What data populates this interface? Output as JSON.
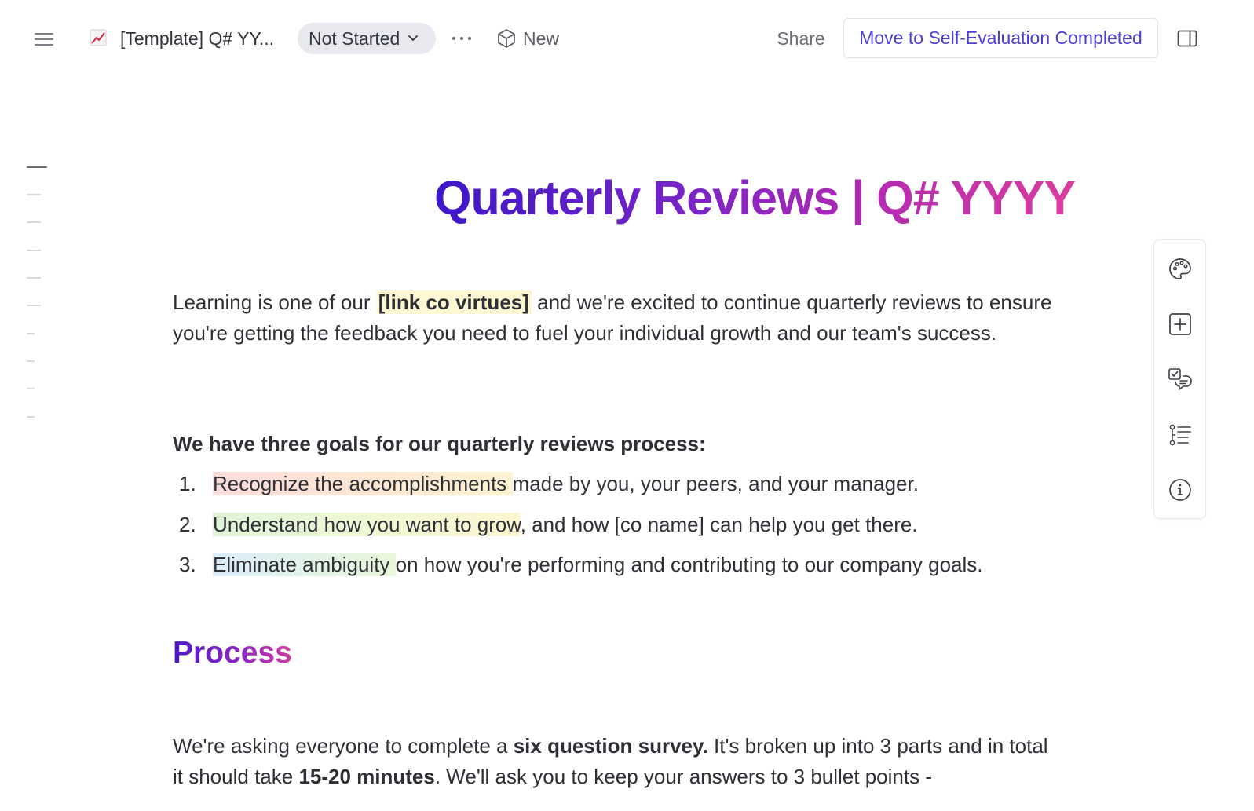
{
  "topbar": {
    "doc_icon": "chart-increasing-emoji-icon",
    "doc_title": "[Template] Q# YY...",
    "status": "Not Started",
    "new_label": "New",
    "share_label": "Share",
    "move_label": "Move to Self-Evaluation Completed"
  },
  "outline": {
    "item_count": 10
  },
  "document": {
    "heading": "Quarterly Reviews | Q#  YYYY",
    "intro": {
      "before": "Learning is one of our ",
      "highlight": "[link co virtues]",
      "after": " and we're excited to continue quarterly reviews to ensure you're getting the feedback you need to fuel your individual growth and our team's success."
    },
    "goals_title": "We have three goals for our quarterly reviews process:",
    "goals": [
      {
        "num": "1.",
        "highlight": "Recognize the accomplishments ",
        "rest": "made by you, your peers, and your manager."
      },
      {
        "num": "2.",
        "highlight": "Understand how you want to grow",
        "rest": ", and how [co name] can help you get there."
      },
      {
        "num": "3.",
        "highlight": "Eliminate ambiguity ",
        "rest": "on how you're performing and contributing to our company goals."
      }
    ],
    "process_heading": "Process",
    "survey": {
      "p1": "We're asking everyone to complete a ",
      "b1": "six question survey.",
      "p2": " It's broken up into 3 parts and in total it should take ",
      "b2": "15-20 minutes",
      "p3": ". We'll ask you to keep your answers to 3 bullet points -"
    }
  },
  "rail": {
    "icons": [
      "palette-icon",
      "add-block-icon",
      "comments-checklist-icon",
      "outline-list-icon",
      "info-icon"
    ]
  },
  "colors": {
    "accent": "#4b3fd6",
    "heading_gradient_start": "#3b17c9",
    "heading_gradient_end": "#da3d9c",
    "status_pill_bg": "#e7e9ef"
  }
}
